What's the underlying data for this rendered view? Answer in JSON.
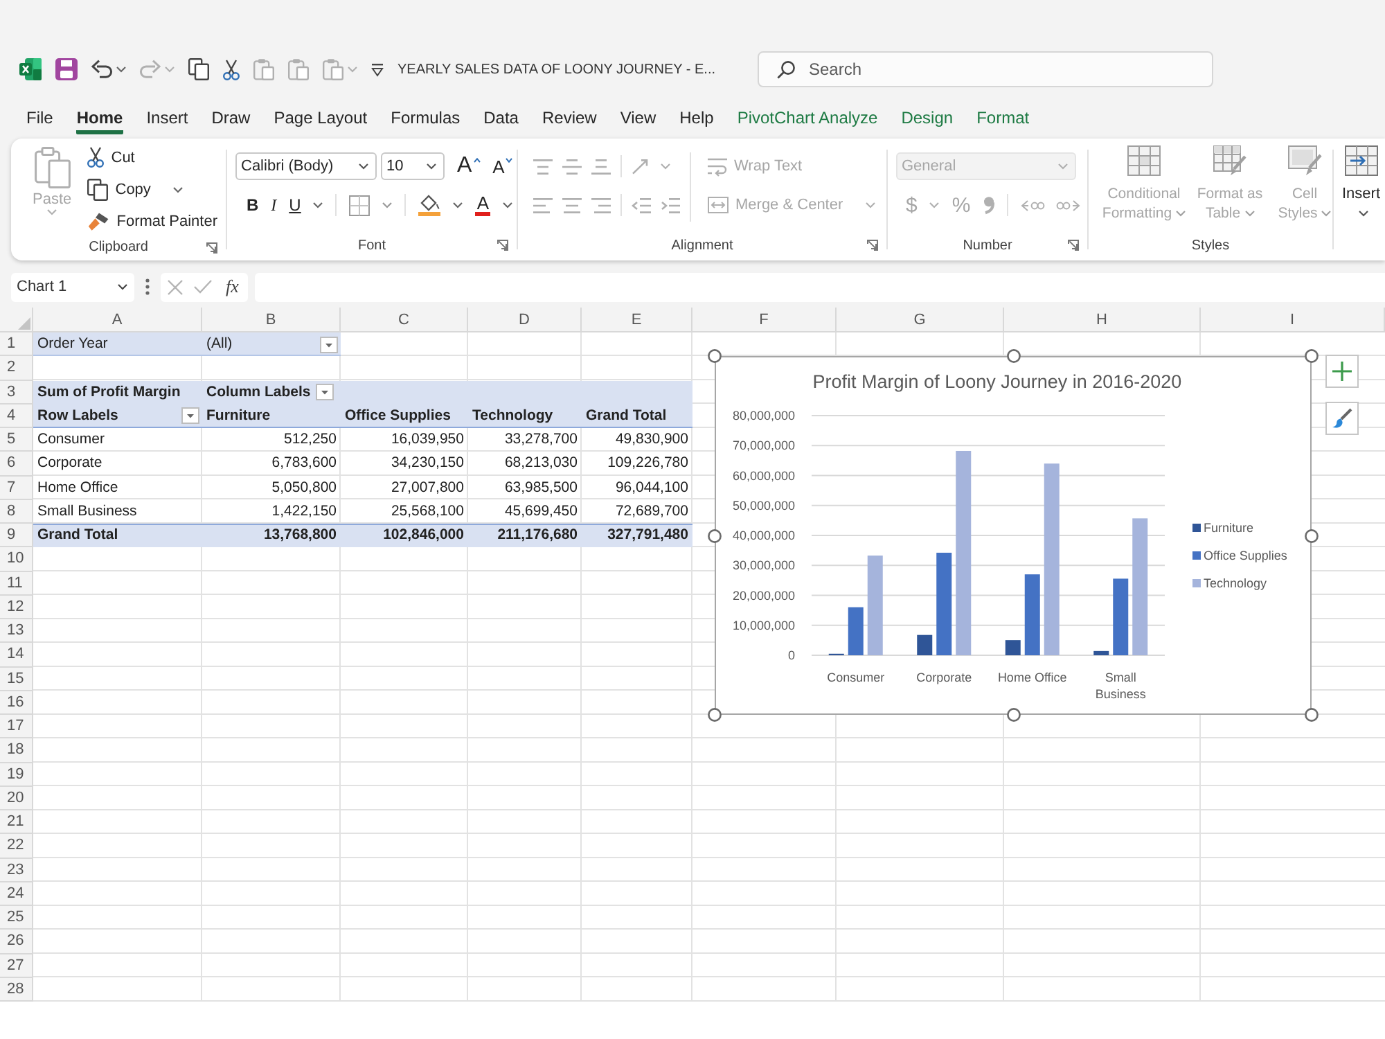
{
  "title_bar": {
    "quick_access": [
      {
        "kind": "save",
        "disabled": false,
        "dropdown": false
      },
      {
        "kind": "undo",
        "disabled": false,
        "dropdown": true
      },
      {
        "kind": "redo",
        "disabled": true,
        "dropdown": true
      },
      {
        "kind": "copy",
        "disabled": false,
        "dropdown": false
      },
      {
        "kind": "cut",
        "disabled": false,
        "dropdown": false
      },
      {
        "kind": "paste",
        "disabled": true,
        "dropdown": false
      },
      {
        "kind": "paste",
        "disabled": true,
        "dropdown": false
      },
      {
        "kind": "paste",
        "disabled": true,
        "dropdown": true
      },
      {
        "kind": "customize",
        "disabled": false,
        "dropdown": false
      }
    ],
    "document_title": "YEARLY SALES DATA OF LOONY JOURNEY - E...",
    "search": {
      "placeholder": "Search"
    }
  },
  "menu_tabs": [
    {
      "label": "File",
      "selected": false,
      "kind": "standard"
    },
    {
      "label": "Home",
      "selected": true,
      "kind": "standard"
    },
    {
      "label": "Insert",
      "selected": false,
      "kind": "standard"
    },
    {
      "label": "Draw",
      "selected": false,
      "kind": "standard"
    },
    {
      "label": "Page Layout",
      "selected": false,
      "kind": "standard"
    },
    {
      "label": "Formulas",
      "selected": false,
      "kind": "standard"
    },
    {
      "label": "Data",
      "selected": false,
      "kind": "standard"
    },
    {
      "label": "Review",
      "selected": false,
      "kind": "standard"
    },
    {
      "label": "View",
      "selected": false,
      "kind": "standard"
    },
    {
      "label": "Help",
      "selected": false,
      "kind": "standard"
    },
    {
      "label": "PivotChart Analyze",
      "selected": false,
      "kind": "contextual"
    },
    {
      "label": "Design",
      "selected": false,
      "kind": "contextual"
    },
    {
      "label": "Format",
      "selected": false,
      "kind": "contextual"
    }
  ],
  "ribbon": {
    "clipboard": {
      "label": "Clipboard",
      "paste": {
        "label": "Paste",
        "disabled": true
      },
      "cut": "Cut",
      "copy": "Copy",
      "format_painter": "Format Painter"
    },
    "font": {
      "label": "Font",
      "font_name": "Calibri (Body)",
      "font_size": "10",
      "increase_size": "A",
      "decrease_size": "A",
      "bold": "B",
      "italic": "I",
      "underline": "U",
      "font_color": "A"
    },
    "alignment": {
      "label": "Alignment",
      "disabled": true,
      "wrap_text": "Wrap Text",
      "merge_center": "Merge & Center"
    },
    "number": {
      "label": "Number",
      "disabled": true,
      "format": "General",
      "currency": "$",
      "percent": "%"
    },
    "styles": {
      "label": "Styles",
      "disabled": true,
      "buttons": [
        "Conditional Formatting",
        "Format as Table",
        "Cell Styles"
      ]
    },
    "cells": {
      "insert": "Insert"
    }
  },
  "formula_bar": {
    "name_box": "Chart 1",
    "function_label": "fx"
  },
  "sheet": {
    "columns": [
      "A",
      "B",
      "C",
      "D",
      "E",
      "F",
      "G",
      "H",
      "I"
    ],
    "row_numbers": [
      "1",
      "2",
      "3",
      "4",
      "5",
      "6",
      "7",
      "8",
      "9",
      "10",
      "11",
      "12",
      "13",
      "14",
      "15",
      "16",
      "17",
      "18",
      "19",
      "20",
      "21",
      "22",
      "23",
      "24",
      "25",
      "26",
      "27",
      "28"
    ],
    "pivot": {
      "filter": {
        "field": "Order Year",
        "value": "(All)"
      },
      "value_label": "Sum of Profit Margin",
      "column_labels": "Column Labels",
      "row_labels": "Row Labels",
      "headers": [
        "Furniture",
        "Office Supplies",
        "Technology",
        "Grand Total"
      ],
      "rows": [
        {
          "label": "Consumer",
          "values": [
            "512,250",
            "16,039,950",
            "33,278,700",
            "49,830,900"
          ]
        },
        {
          "label": "Corporate",
          "values": [
            "6,783,600",
            "34,230,150",
            "68,213,030",
            "109,226,780"
          ]
        },
        {
          "label": "Home Office",
          "values": [
            "5,050,800",
            "27,007,800",
            "63,985,500",
            "96,044,100"
          ]
        },
        {
          "label": "Small Business",
          "values": [
            "1,422,150",
            "25,568,100",
            "45,699,450",
            "72,689,700"
          ]
        }
      ],
      "grand_total": {
        "label": "Grand Total",
        "values": [
          "13,768,800",
          "102,846,000",
          "211,176,680",
          "327,791,480"
        ]
      }
    }
  },
  "chart": {
    "chart_data": [
      {
        "type": "bar",
        "title": "Profit Margin of Loony Journey in 2016-2020",
        "categories": [
          "Consumer",
          "Corporate",
          "Home Office",
          "Small Business"
        ],
        "series": [
          {
            "name": "Furniture",
            "color": "#2f5597",
            "values": [
              512250,
              6783600,
              5050800,
              1422150
            ]
          },
          {
            "name": "Office Supplies",
            "color": "#4472c4",
            "values": [
              16039950,
              34230150,
              27007800,
              25568100
            ]
          },
          {
            "name": "Technology",
            "color": "#a5b4dc",
            "values": [
              33278700,
              68213030,
              63985500,
              45699450
            ]
          }
        ],
        "ylim": [
          0,
          80000000
        ],
        "yticks": [
          {
            "value": 0,
            "label": "0"
          },
          {
            "value": 10000000,
            "label": "10,000,000"
          },
          {
            "value": 20000000,
            "label": "20,000,000"
          },
          {
            "value": 30000000,
            "label": "30,000,000"
          },
          {
            "value": 40000000,
            "label": "40,000,000"
          },
          {
            "value": 50000000,
            "label": "50,000,000"
          },
          {
            "value": 60000000,
            "label": "60,000,000"
          },
          {
            "value": 70000000,
            "label": "70,000,000"
          },
          {
            "value": 80000000,
            "label": "80,000,000"
          }
        ],
        "grid": true,
        "legend": "right"
      }
    ]
  }
}
